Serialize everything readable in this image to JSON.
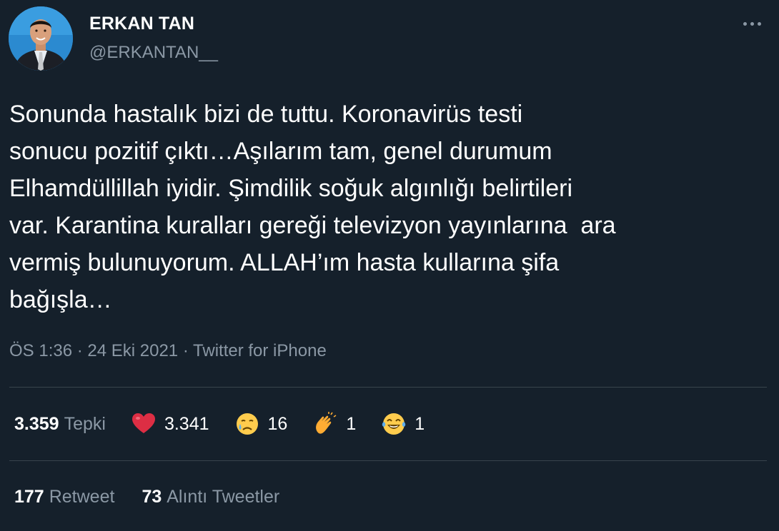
{
  "user": {
    "name": "ERKAN TAN",
    "handle": "@ERKANTAN__"
  },
  "tweet": {
    "text": "Sonunda hastalık bizi de tuttu. Koronavirüs testi\nsonucu pozitif çıktı…Aşılarım tam, genel durumum\nElhamdüllillah iyidir. Şimdilik soğuk algınlığı belirtileri\nvar. Karantina kuralları gereği televizyon yayınlarına  ara\nvermiş bulunuyorum. ALLAH’ım hasta kullarına şifa\nbağışla…",
    "meta": "ÖS 1:36 · 24 Eki 2021 · Twitter for iPhone"
  },
  "reactions": {
    "total": "3.359",
    "total_label": "Tepki",
    "items": [
      {
        "icon": "red-heart-icon",
        "count": "3.341"
      },
      {
        "icon": "crying-face-icon",
        "count": "16"
      },
      {
        "icon": "clapping-hands-icon",
        "count": "1"
      },
      {
        "icon": "tears-of-joy-icon",
        "count": "1"
      }
    ]
  },
  "engagement": {
    "retweets": "177",
    "retweets_label": "Retweet",
    "quotes": "73",
    "quotes_label": "Alıntı Tweetler"
  },
  "colors": {
    "background": "#15202b",
    "text": "#ffffff",
    "muted": "#8b98a5",
    "divider": "#38444d"
  }
}
